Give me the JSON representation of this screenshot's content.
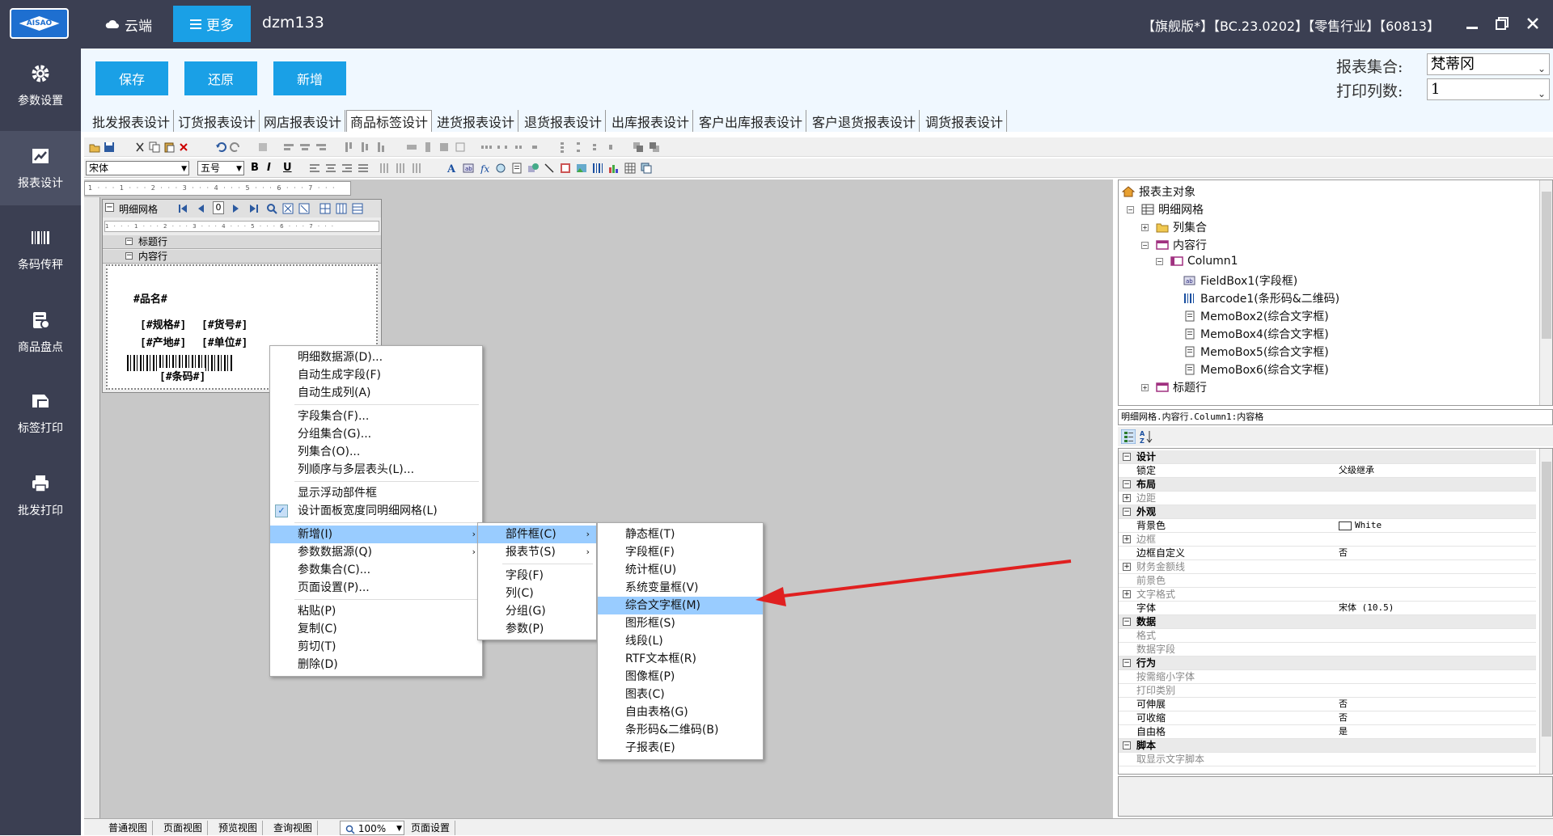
{
  "titlebar": {
    "cloud_label": "云端",
    "more_label": "更多",
    "user": "dzm133",
    "version": "【旗舰版*】【BC.23.0202】【零售行业】【60813】",
    "logo_text": "AISAO"
  },
  "sidebar": {
    "items": [
      {
        "label": "参数设置",
        "icon": "gear-icon"
      },
      {
        "label": "报表设计",
        "icon": "chart-icon"
      },
      {
        "label": "条码传秤",
        "icon": "barcode-icon"
      },
      {
        "label": "商品盘点",
        "icon": "inventory-icon"
      },
      {
        "label": "标签打印",
        "icon": "label-icon"
      },
      {
        "label": "批发打印",
        "icon": "printer-icon"
      }
    ]
  },
  "actions": {
    "save": "保存",
    "restore": "还原",
    "add": "新增",
    "report_set_label": "报表集合:",
    "report_set_value": "梵蒂冈",
    "print_cols_label": "打印列数:",
    "print_cols_value": "1"
  },
  "tabs": [
    "批发报表设计",
    "订货报表设计",
    "网店报表设计",
    "商品标签设计",
    "进货报表设计",
    "退货报表设计",
    "出库报表设计",
    "客户出库报表设计",
    "客户退货报表设计",
    "调货报表设计"
  ],
  "format_toolbar": {
    "font_name": "宋体",
    "font_size": "五号",
    "bold": "B",
    "italic": "I",
    "underline": "U"
  },
  "ruler_text": "1 · · · 1 · · · 2 · · · 3 · · · 4 · · · 5 · · · 6 · · · 7 · · ·",
  "grid_panel": {
    "title": "明细网格",
    "page_input": "0",
    "header_row": "标题行",
    "content_row": "内容行"
  },
  "label_fields": {
    "name": "#品名#",
    "spec": "[#规格#]",
    "code": "[#货号#]",
    "origin": "[#产地#]",
    "unit": "[#单位#]",
    "barcode": "[#条码#]"
  },
  "context_menu": {
    "items": [
      "明细数据源(D)...",
      "自动生成字段(F)",
      "自动生成列(A)",
      "字段集合(F)...",
      "分组集合(G)...",
      "列集合(O)...",
      "列顺序与多层表头(L)...",
      "显示浮动部件框",
      "设计面板宽度同明细网格(L)",
      "新增(I)",
      "参数数据源(Q)",
      "参数集合(C)...",
      "页面设置(P)...",
      "粘贴(P)",
      "复制(C)",
      "剪切(T)",
      "删除(D)"
    ],
    "checked_item": "设计面板宽度同明细网格(L)",
    "highlighted_item": "新增(I)"
  },
  "submenu_add": {
    "items": [
      "部件框(C)",
      "报表节(S)",
      "字段(F)",
      "列(C)",
      "分组(G)",
      "参数(P)"
    ],
    "highlighted_item": "部件框(C)"
  },
  "submenu_widget": {
    "items": [
      "静态框(T)",
      "字段框(F)",
      "统计框(U)",
      "系统变量框(V)",
      "综合文字框(M)",
      "图形框(S)",
      "线段(L)",
      "RTF文本框(R)",
      "图像框(P)",
      "图表(C)",
      "自由表格(G)",
      "条形码&二维码(B)",
      "子报表(E)"
    ],
    "highlighted_item": "综合文字框(M)"
  },
  "tree": {
    "root": "报表主对象",
    "items": [
      {
        "label": "明细网格",
        "level": 1
      },
      {
        "label": "列集合",
        "level": 2
      },
      {
        "label": "内容行",
        "level": 2
      },
      {
        "label": "Column1",
        "level": 3
      },
      {
        "label": "FieldBox1(字段框)",
        "level": 4
      },
      {
        "label": "Barcode1(条形码&二维码)",
        "level": 4
      },
      {
        "label": "MemoBox2(综合文字框)",
        "level": 4
      },
      {
        "label": "MemoBox4(综合文字框)",
        "level": 4
      },
      {
        "label": "MemoBox5(综合文字框)",
        "level": 4
      },
      {
        "label": "MemoBox6(综合文字框)",
        "level": 4
      },
      {
        "label": "标题行",
        "level": 2
      }
    ]
  },
  "prop_path": "明细网格.内容行.Column1:内容格",
  "properties": [
    {
      "key": "设计",
      "cat": true
    },
    {
      "key": "锁定",
      "val": "父级继承"
    },
    {
      "key": "布局",
      "cat": true
    },
    {
      "key": "边距",
      "dim": true,
      "plus": true
    },
    {
      "key": "外观",
      "cat": true
    },
    {
      "key": "背景色",
      "val": "White",
      "swatch": "#ffffff"
    },
    {
      "key": "边框",
      "dim": true,
      "plus": true
    },
    {
      "key": "边框自定义",
      "val": "否"
    },
    {
      "key": "财务金额线",
      "dim": true,
      "plus": true
    },
    {
      "key": "前景色",
      "dim": true
    },
    {
      "key": "文字格式",
      "dim": true,
      "plus": true
    },
    {
      "key": "字体",
      "val": "宋体 (10.5)"
    },
    {
      "key": "数据",
      "cat": true
    },
    {
      "key": "格式",
      "dim": true
    },
    {
      "key": "数据字段",
      "dim": true
    },
    {
      "key": "行为",
      "cat": true
    },
    {
      "key": "按需缩小字体",
      "dim": true
    },
    {
      "key": "打印类别",
      "dim": true
    },
    {
      "key": "可伸展",
      "val": "否"
    },
    {
      "key": "可收缩",
      "val": "否"
    },
    {
      "key": "自由格",
      "val": "是"
    },
    {
      "key": "脚本",
      "cat": true
    },
    {
      "key": "取显示文字脚本",
      "dim": true
    }
  ],
  "statusbar": {
    "items": [
      "普通视图",
      "页面视图",
      "预览视图",
      "查询视图"
    ],
    "zoom": "100%",
    "page_setup": "页面设置"
  },
  "colors": {
    "chrome": "#3b3f52",
    "accent": "#1aa0e6",
    "highlight": "#99ccff",
    "arrow": "#e02020"
  }
}
